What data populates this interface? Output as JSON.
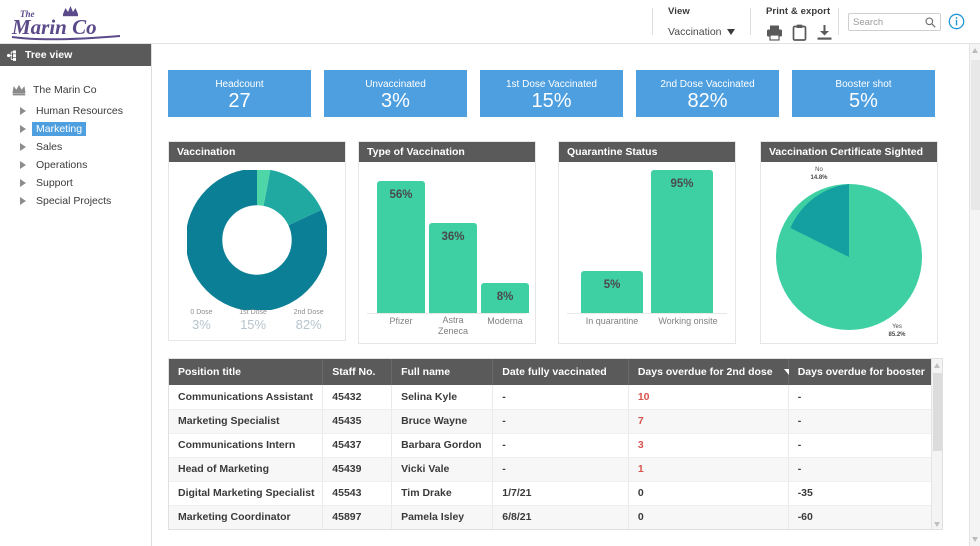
{
  "header": {
    "logo_text": "The Marin Co",
    "view": {
      "label": "View",
      "selected": "Vaccination"
    },
    "print": {
      "label": "Print & export"
    },
    "search": {
      "placeholder": "Search",
      "value": ""
    }
  },
  "sidebar": {
    "header": "Tree view",
    "root": "The Marin Co",
    "items": [
      {
        "label": "Human Resources",
        "selected": false
      },
      {
        "label": "Marketing",
        "selected": true
      },
      {
        "label": "Sales",
        "selected": false
      },
      {
        "label": "Operations",
        "selected": false
      },
      {
        "label": "Support",
        "selected": false
      },
      {
        "label": "Special Projects",
        "selected": false
      }
    ]
  },
  "kpis": [
    {
      "title": "Headcount",
      "value": "27"
    },
    {
      "title": "Unvaccinated",
      "value": "3%"
    },
    {
      "title": "1st Dose Vaccinated",
      "value": "15%"
    },
    {
      "title": "2nd Dose Vaccinated",
      "value": "82%"
    },
    {
      "title": "Booster shot",
      "value": "5%"
    }
  ],
  "panels": {
    "donut_title": "Vaccination",
    "bars_title": "Type of Vaccination",
    "quarantine_title": "Quarantine Status",
    "pie_title": "Vaccination Certificate Sighted"
  },
  "chart_data": [
    {
      "type": "pie",
      "title": "Vaccination",
      "variant": "donut",
      "categories": [
        "0 Dose",
        "1st Dose",
        "2nd Dose"
      ],
      "values": [
        3,
        15,
        82
      ],
      "labels": [
        "3%",
        "15%",
        "82%"
      ],
      "colors": [
        "#4ed6a8",
        "#1fa9a0",
        "#0b7f96"
      ],
      "legend": "bottom"
    },
    {
      "type": "bar",
      "title": "Type of Vaccination",
      "categories": [
        "Pfizer",
        "Astra Zeneca",
        "Moderna"
      ],
      "values": [
        56,
        36,
        8
      ],
      "labels": [
        "56%",
        "36%",
        "8%"
      ],
      "xlabel": "",
      "ylabel": "",
      "ylim": [
        0,
        60
      ],
      "color": "#3ecfa3",
      "grid": false
    },
    {
      "type": "bar",
      "title": "Quarantine Status",
      "categories": [
        "In quarantine",
        "Working onsite"
      ],
      "values": [
        5,
        95
      ],
      "labels": [
        "5%",
        "95%"
      ],
      "xlabel": "",
      "ylabel": "",
      "ylim": [
        0,
        100
      ],
      "color": "#3ecfa3",
      "grid": false
    },
    {
      "type": "pie",
      "title": "Vaccination Certificate Sighted",
      "categories": [
        "Yes",
        "No"
      ],
      "values": [
        85.2,
        14.8
      ],
      "labels": [
        "85.2%",
        "14.8%"
      ],
      "colors": [
        "#3ecfa3",
        "#14a0a0"
      ],
      "legend": "callout"
    }
  ],
  "table": {
    "columns": [
      "Position title",
      "Staff No.",
      "Full name",
      "Date fully vaccinated",
      "Days overdue for 2nd dose",
      "Days overdue for booster"
    ],
    "sorted_column_index": 4,
    "rows": [
      {
        "position": "Communications Assistant",
        "staff": "45432",
        "name": "Selina Kyle",
        "date": "-",
        "overdue2": "10",
        "overdue2_late": true,
        "booster": "-"
      },
      {
        "position": "Marketing Specialist",
        "staff": "45435",
        "name": "Bruce Wayne",
        "date": "-",
        "overdue2": "7",
        "overdue2_late": true,
        "booster": "-"
      },
      {
        "position": "Communications Intern",
        "staff": "45437",
        "name": "Barbara Gordon",
        "date": "-",
        "overdue2": "3",
        "overdue2_late": true,
        "booster": "-"
      },
      {
        "position": "Head of Marketing",
        "staff": "45439",
        "name": "Vicki Vale",
        "date": "-",
        "overdue2": "1",
        "overdue2_late": true,
        "booster": "-"
      },
      {
        "position": "Digital Marketing Specialist",
        "staff": "45543",
        "name": "Tim Drake",
        "date": "1/7/21",
        "overdue2": "0",
        "overdue2_late": false,
        "booster": "-35"
      },
      {
        "position": "Marketing Coordinator",
        "staff": "45897",
        "name": "Pamela Isley",
        "date": "6/8/21",
        "overdue2": "0",
        "overdue2_late": false,
        "booster": "-60"
      }
    ]
  },
  "colors": {
    "accent_blue": "#4e9fe0",
    "panel_header": "#5a5a5a",
    "green": "#3ecfa3",
    "teal": "#14a0a0",
    "dark_teal": "#0b7f96",
    "overdue_red": "#d9534f"
  }
}
